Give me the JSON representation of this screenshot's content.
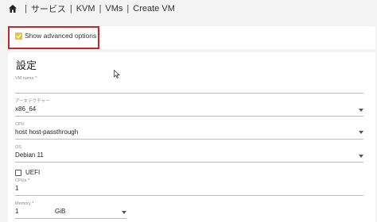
{
  "breadcrumb": {
    "items": [
      "サービス",
      "KVM",
      "VMs",
      "Create VM"
    ],
    "separator": "|"
  },
  "advanced": {
    "label": "Show advanced options",
    "checked": true
  },
  "settings": {
    "title": "設定",
    "vm_name": {
      "label": "VM name *",
      "value": ""
    },
    "architecture": {
      "label": "アーキテクチャー",
      "value": "x86_64"
    },
    "cpu": {
      "label": "CPU",
      "value": "host host-passthrough"
    },
    "os": {
      "label": "OS",
      "value": "Debian 11"
    },
    "uefi": {
      "label": "UEFI",
      "checked": false
    },
    "cpus": {
      "label": "CPUs *",
      "value": "1"
    },
    "memory": {
      "label": "Memory *",
      "value": "1",
      "unit": "GiB"
    }
  },
  "colors": {
    "highlight": "#c8262a",
    "checkbox": "#e8c53a"
  }
}
